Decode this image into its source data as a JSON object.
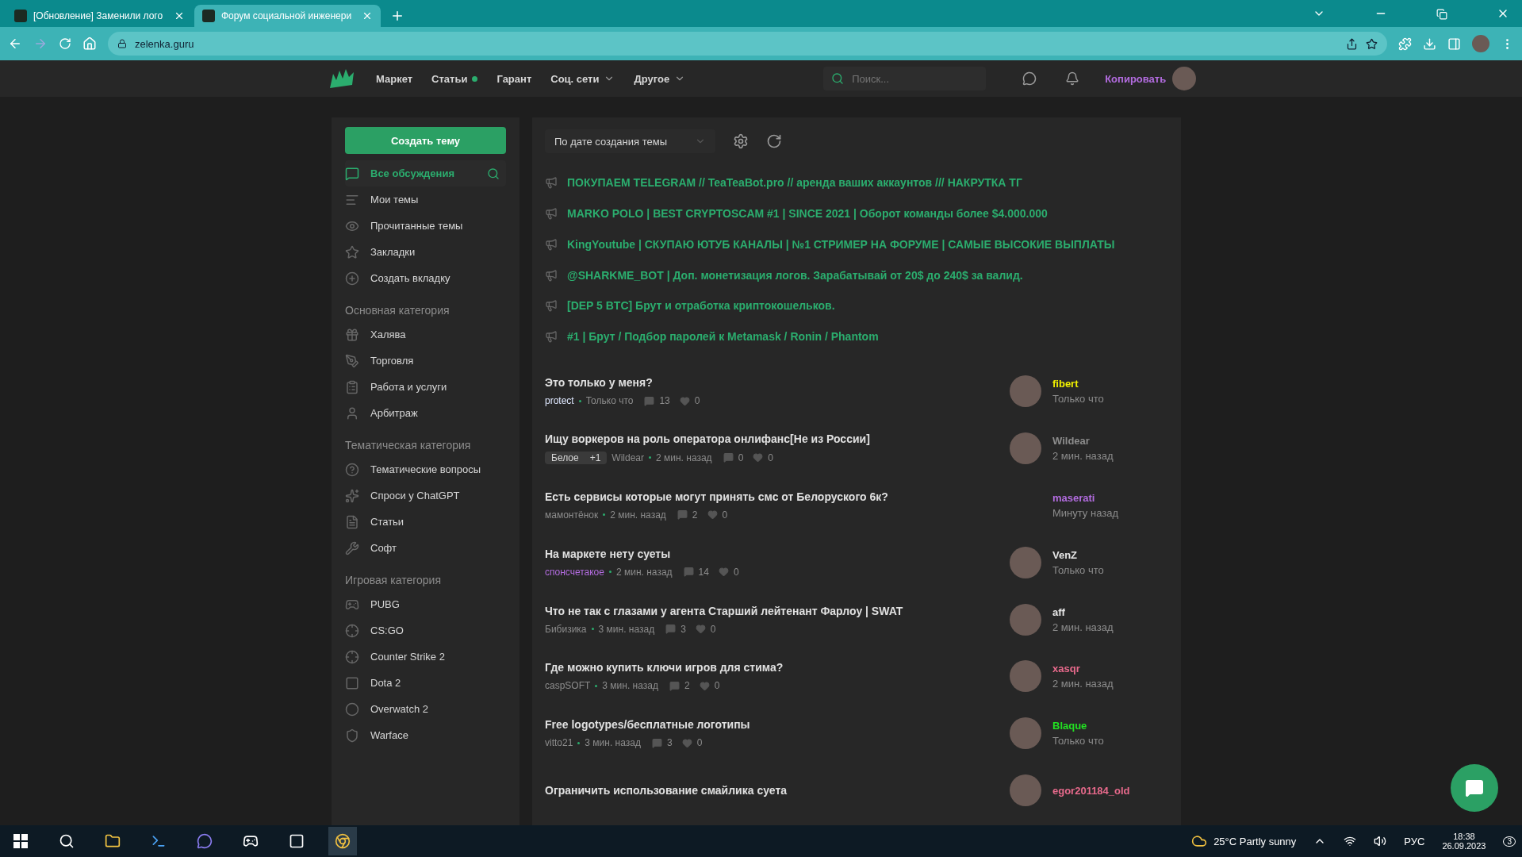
{
  "browser": {
    "tabs": [
      {
        "title": "[Обновление] Заменили лого",
        "selected": false
      },
      {
        "title": "Форум социальной инженери",
        "selected": true
      }
    ],
    "url": "zelenka.guru"
  },
  "header": {
    "nav": [
      {
        "label": "Маркет",
        "dot": false,
        "dropdown": false
      },
      {
        "label": "Статьи",
        "dot": true,
        "dropdown": false
      },
      {
        "label": "Гарант",
        "dot": false,
        "dropdown": false
      },
      {
        "label": "Соц. сети",
        "dot": false,
        "dropdown": true
      },
      {
        "label": "Другое",
        "dot": false,
        "dropdown": true
      }
    ],
    "search_placeholder": "Поиск...",
    "username": "Копировать"
  },
  "sidebar": {
    "create_button": "Создать тему",
    "nav": [
      {
        "label": "Все обсуждения",
        "selected": true
      },
      {
        "label": "Мои темы",
        "selected": false
      },
      {
        "label": "Прочитанные темы",
        "selected": false
      },
      {
        "label": "Закладки",
        "selected": false
      },
      {
        "label": "Создать вкладку",
        "selected": false
      }
    ],
    "sections": [
      {
        "title": "Основная категория",
        "items": [
          "Халява",
          "Торговля",
          "Работа и услуги",
          "Арбитраж"
        ]
      },
      {
        "title": "Тематическая категория",
        "items": [
          "Тематические вопросы",
          "Спроси у ChatGPT",
          "Статьи",
          "Софт"
        ]
      },
      {
        "title": "Игровая категория",
        "items": [
          "PUBG",
          "CS:GO",
          "Counter Strike 2",
          "Dota 2",
          "Overwatch 2",
          "Warface"
        ]
      }
    ]
  },
  "main": {
    "sort": "По дате создания темы",
    "pinned": [
      "ПОКУПАЕМ TELEGRAM // TeaTeaBot.pro // аренда ваших аккаунтов /// НАКРУТКА ТГ",
      "MARKO POLO | BEST CRYPTOSCAM #1 | SINCE 2021 | Оборот команды более $4.000.000",
      "KingYoutube | СКУПАЮ ЮТУБ КАНАЛЫ | №1 СТРИМЕР НА ФОРУМЕ | САМЫЕ ВЫСОКИЕ ВЫПЛАТЫ",
      "@SHARKME_BOT | Доп. монетизация логов. Зарабатывай от 20$ до 240$ за валид.",
      "[DEP 5 BTC] Брут и отработка криптокошельков.",
      "#1 | Брут / Подбор паролей к Metamask / Ronin / Phantom"
    ],
    "threads": [
      {
        "title": "Это только у меня?",
        "author": {
          "name": "protect",
          "color": "#dfe8ff"
        },
        "time": "Только что",
        "replies": "13",
        "likes": "0",
        "last": {
          "name": "fibert",
          "color": "#f0f000",
          "time": "Только что",
          "avatar": true
        }
      },
      {
        "title": "Ищу воркеров на роль оператора онлифанс[Не из России]",
        "tag": {
          "label": "Белое",
          "extra": "+1"
        },
        "author": {
          "name": "Wildear",
          "color": "#8c8c8c"
        },
        "time": "2 мин. назад",
        "replies": "0",
        "likes": "0",
        "last": {
          "name": "Wildear",
          "color": "#8c8c8c",
          "time": "2 мин. назад",
          "avatar": true
        }
      },
      {
        "title": "Есть сервисы которые могут принять смс от Белоруского 6к?",
        "author": {
          "name": "мамонтёнок",
          "color": "#8c8c8c"
        },
        "time": "2 мин. назад",
        "replies": "2",
        "likes": "0",
        "last": {
          "name": "maserati",
          "color": "#b36ce0",
          "time": "Минуту назад",
          "avatar": false
        }
      },
      {
        "title": "На маркете нету суеты",
        "author": {
          "name": "спонсчетакое",
          "color": "#b36ce0"
        },
        "time": "2 мин. назад",
        "replies": "14",
        "likes": "0",
        "last": {
          "name": "VenZ",
          "color": "#e6e6e6",
          "time": "Только что",
          "avatar": true
        }
      },
      {
        "title": "Что не так с глазами у агента Старший лейтенант Фарлоу | SWAT",
        "author": {
          "name": "Бибизика",
          "color": "#8c8c8c"
        },
        "time": "3 мин. назад",
        "replies": "3",
        "likes": "0",
        "last": {
          "name": "aff",
          "color": "#e6e6e6",
          "time": "2 мин. назад",
          "avatar": true
        }
      },
      {
        "title": "Где можно купить ключи игров для стима?",
        "author": {
          "name": "caspSOFT",
          "color": "#8c8c8c"
        },
        "time": "3 мин. назад",
        "replies": "2",
        "likes": "0",
        "last": {
          "name": "xasqr",
          "color": "#e86a8c",
          "time": "2 мин. назад",
          "avatar": true
        }
      },
      {
        "title": "Free logotypes/бесплатные логотипы",
        "author": {
          "name": "vitto21",
          "color": "#8c8c8c"
        },
        "time": "3 мин. назад",
        "replies": "3",
        "likes": "0",
        "last": {
          "name": "Blaque",
          "color": "#22e022",
          "time": "Только что",
          "avatar": true
        }
      },
      {
        "title": "Ограничить использование смайлика суета",
        "last": {
          "name": "egor201184_old",
          "color": "#e86a8c",
          "avatar": true
        }
      }
    ]
  },
  "taskbar": {
    "weather": "25°C Partly sunny",
    "language": "РУС",
    "time": "18:38",
    "date": "26.09.2023",
    "notifications": "3"
  }
}
